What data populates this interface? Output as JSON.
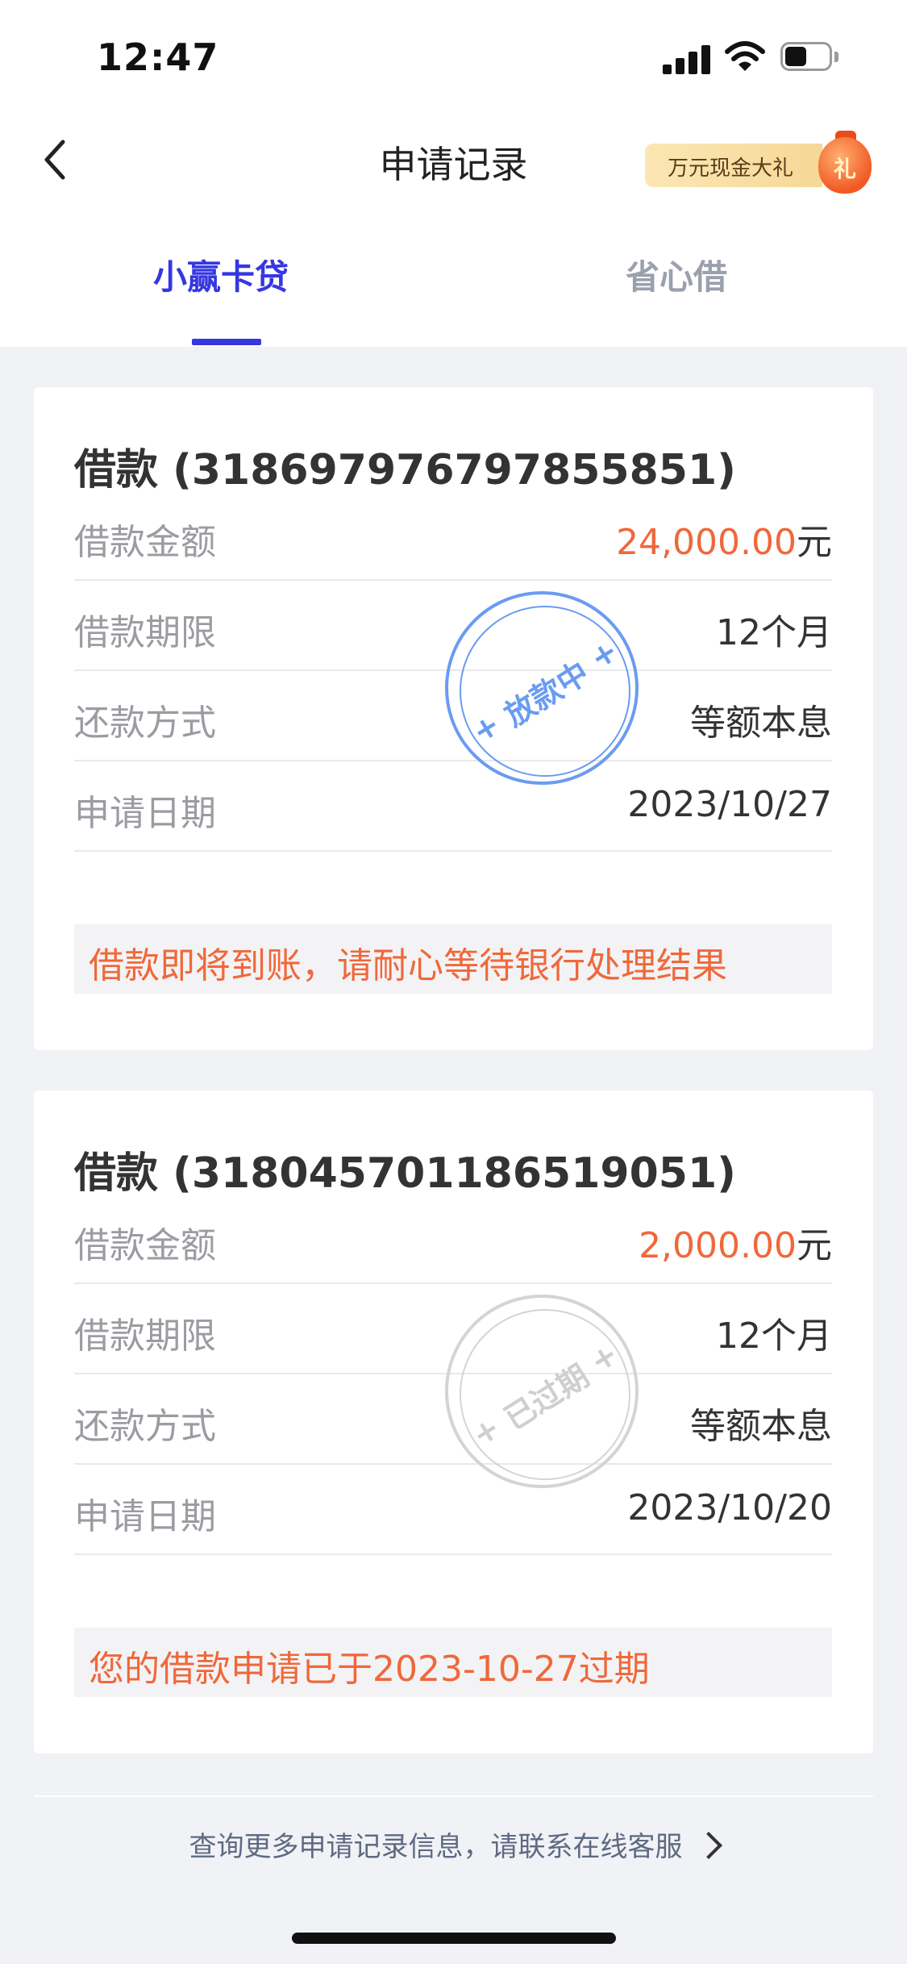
{
  "status_bar": {
    "time": "12:47"
  },
  "nav": {
    "title": "申请记录",
    "promo_text": "万元现金大礼",
    "promo_badge": "礼"
  },
  "tabs": [
    {
      "label": "小赢卡贷",
      "active": true
    },
    {
      "label": "省心借",
      "active": false
    }
  ],
  "loans": [
    {
      "title": "借款 (318697976797855851)",
      "stamp": "放款中",
      "rows": [
        {
          "label": "借款金额",
          "value": "24,000.00",
          "unit": "元"
        },
        {
          "label": "借款期限",
          "value": "12个月"
        },
        {
          "label": "还款方式",
          "value": "等额本息"
        },
        {
          "label": "申请日期",
          "value": "2023/10/27"
        }
      ],
      "notice": "借款即将到账，请耐心等待银行处理结果"
    },
    {
      "title": "借款 (318045701186519051)",
      "stamp": "已过期",
      "rows": [
        {
          "label": "借款金额",
          "value": "2,000.00",
          "unit": "元"
        },
        {
          "label": "借款期限",
          "value": "12个月"
        },
        {
          "label": "还款方式",
          "value": "等额本息"
        },
        {
          "label": "申请日期",
          "value": "2023/10/20"
        }
      ],
      "notice": "您的借款申请已于2023-10-27过期"
    }
  ],
  "footer": {
    "text": "查询更多申请记录信息，请联系在线客服"
  },
  "colors": {
    "accent": "#3637e0",
    "amount": "#f0683a",
    "stamp_active": "#6a9cf0",
    "stamp_expired": "#d4d4d6"
  }
}
